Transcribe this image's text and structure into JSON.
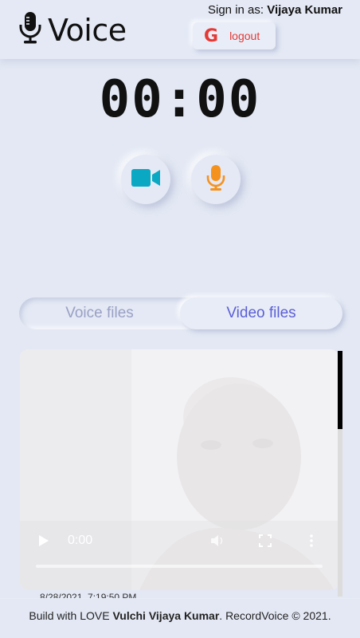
{
  "header": {
    "app_title": "Voice",
    "signin_prefix": "Sign in as: ",
    "user_name": "Vijaya Kumar",
    "logout_icon": "G",
    "logout_label": "logout"
  },
  "recorder": {
    "timer": "00:00",
    "video_button_icon": "video-camera-icon",
    "mic_button_icon": "microphone-icon",
    "video_color": "#0aa8c2",
    "mic_color": "#f5921e"
  },
  "tabs": [
    {
      "label": "Voice files",
      "active": false
    },
    {
      "label": "Video files",
      "active": true
    }
  ],
  "video_item": {
    "current_time": "0:00",
    "date": "8/28/2021, 7:19:50 PM"
  },
  "footer": {
    "prefix": "Build with LOVE ",
    "author": "Vulchi Vijaya Kumar",
    "suffix": ". RecordVoice © 2021."
  }
}
